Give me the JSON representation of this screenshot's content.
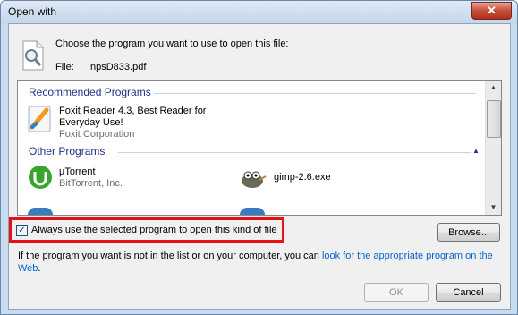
{
  "window": {
    "title": "Open with",
    "close_glyph": "✕"
  },
  "header": {
    "prompt": "Choose the program you want to use to open this file:",
    "file_label": "File:",
    "file_name": "npsD833.pdf",
    "icon": "document-search-icon"
  },
  "list": {
    "recommended_header": "Recommended Programs",
    "other_header": "Other Programs",
    "recommended": [
      {
        "name_line1": "Foxit Reader 4.3, Best Reader for",
        "name_line2": "Everyday Use!",
        "publisher": "Foxit Corporation",
        "icon": "foxit-reader-icon"
      }
    ],
    "other": [
      {
        "name": "µTorrent",
        "publisher": "BitTorrent, Inc.",
        "icon": "utorrent-icon"
      },
      {
        "name": "gimp-2.6.exe",
        "publisher": "",
        "icon": "gimp-icon"
      }
    ],
    "collapse_glyph": "▲"
  },
  "checkbox": {
    "label": "Always use the selected program to open this kind of file",
    "checked": true,
    "check_glyph": "✓"
  },
  "buttons": {
    "browse": "Browse...",
    "ok": "OK",
    "cancel": "Cancel"
  },
  "info": {
    "text": "If the program you want is not in the list or on your computer, you can ",
    "link": "look for the appropriate program on the Web",
    "end": "."
  },
  "scrollbar": {
    "up_glyph": "▲",
    "down_glyph": "▼"
  },
  "colors": {
    "accent_link": "#0066cc",
    "group_header": "#1e3287",
    "highlight_border": "#e51316"
  }
}
